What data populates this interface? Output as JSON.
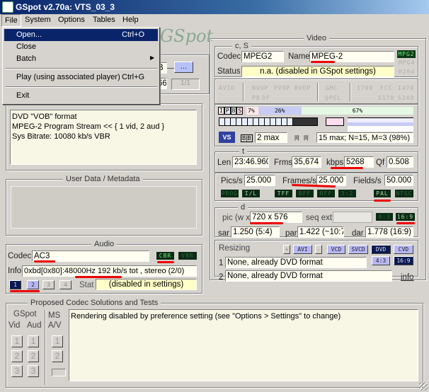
{
  "window": {
    "title": "GSpot v2.70a: VTS_03_3",
    "logo": "GSpot"
  },
  "menubar": [
    "File",
    "System",
    "Options",
    "Tables",
    "Help"
  ],
  "file_menu": [
    {
      "label": "Open...",
      "shortcut": "Ctrl+O"
    },
    {
      "label": "Close"
    },
    {
      "label": "Batch",
      "submenu": true
    },
    {
      "label": "Play (using associated player)",
      "shortcut": "Ctrl+G"
    },
    {
      "label": "Exit"
    }
  ],
  "file_group": {
    "partial_b": "B",
    "browse_label": "...",
    "partial_size": "66",
    "part_label": "1/1"
  },
  "container": {
    "title": "Container",
    "lines": [
      "DVD \"VOB\" format",
      "MPEG-2 Program Stream << { 1 vid, 2 aud }",
      "Sys Bitrate: 10080 kb/s VBR"
    ]
  },
  "userdata": {
    "title": "User Data / Metadata"
  },
  "audio": {
    "title": "Audio",
    "codec_label": "Codec",
    "codec": "AC3",
    "cbr": "CBR",
    "vbr": "VBR",
    "info_label": "Info",
    "info": "0xbd[0x80]:48000Hz  192 kb/s tot , stereo (2/0)",
    "streams": [
      "1",
      "2",
      "3",
      "4"
    ],
    "active_stream": "1",
    "stat_label": "Stat",
    "stat": "(disabled in settings)"
  },
  "video": {
    "title": "Video",
    "cs_title": "c, S",
    "codec_label": "Codec",
    "codec": "MPEG2",
    "name_label": "Name",
    "name": "MPEG-2",
    "status_label": "Status",
    "status": "n.a. (disabled in GSpot settings)",
    "fmt_leds": [
      "MPG2",
      "MPG4",
      "H264"
    ],
    "flags_row1": [
      "AVID",
      "NVOP",
      "PVOP",
      "BVOP",
      "GMC",
      "I709",
      "FCC",
      "I470"
    ],
    "flags_row2": [
      "PB",
      "DF",
      "QPEL",
      "S170",
      "S240"
    ],
    "ipbs": [
      "I",
      "P",
      "B",
      "S"
    ],
    "frame_pcts": {
      "I": "7%",
      "P": "26%",
      "B": "67%"
    },
    "bframes": "2 max",
    "gop": "15 max; N=15, M=3 (98%)",
    "t_title": "t",
    "len_label": "Len",
    "len": "23:46.960",
    "frms_label": "Frms",
    "frms": "35,674",
    "kbps_label": "kbps",
    "kbps": "5268",
    "qf_label": "Qf",
    "qf": "0.508",
    "pics_label": "Pics/s",
    "pics": "25.000",
    "frames_label": "Frames/s",
    "frames": "25.000",
    "fields_label": "Fields/s",
    "fields": "50.000",
    "scan_leds": [
      "PROG",
      "I/L",
      "TFF",
      "BFF",
      "RFF",
      "3:2",
      "PAL",
      "NTSC"
    ],
    "d_title": "d",
    "pic_label": "pic (w x",
    "pic": "720 x 576",
    "seqext_label": "seq ext",
    "ar_leds": [
      "4:3",
      "16:9"
    ],
    "sar_label": "sar",
    "sar": "1.250 (5:4)",
    "par_label": "par",
    "par": "1.422 (~10:7)",
    "dar_label": "dar",
    "dar": "1.778 (16:9)",
    "resizing_label": "Resizing",
    "resize_buttons": [
      "+",
      "AVI",
      "-",
      "VCD",
      "SVCD",
      "DVD",
      "CVD"
    ],
    "resize_ar": [
      "4:3",
      "16:9"
    ],
    "resize1_num": "1",
    "resize1": "None, already DVD format",
    "resize2_num": "2",
    "resize2": "None, already DVD format",
    "info_link": "info"
  },
  "proposed": {
    "title": "Proposed Codec Solutions and Tests",
    "gspot": "GSpot",
    "vid": "Vid",
    "aud": "Aud",
    "ms": "MS",
    "av": "A/V",
    "message": "Rendering disabled by preference setting (see \"Options > Settings\" to change)",
    "nums": [
      "1",
      "2",
      "3"
    ]
  }
}
